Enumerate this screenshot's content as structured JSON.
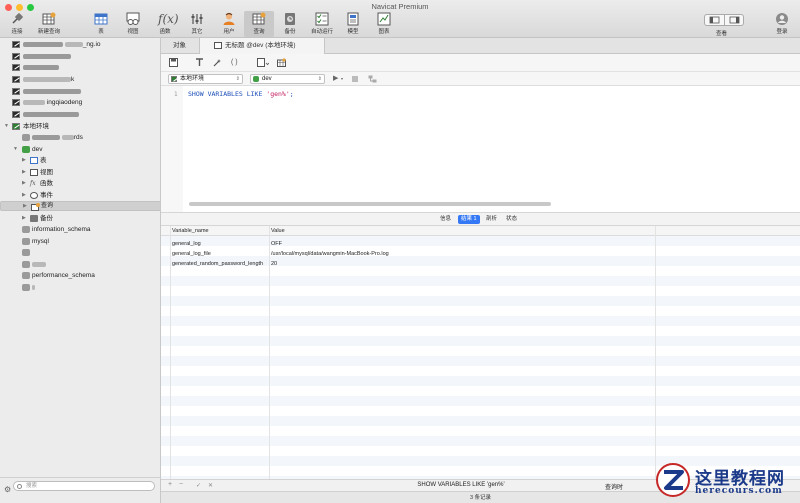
{
  "window": {
    "title": "Navicat Premium",
    "traffic_colors": [
      "#fe5f57",
      "#febc2e",
      "#28c840"
    ]
  },
  "toolbar": {
    "items": [
      {
        "label": "连接",
        "icon": "plug-connect-icon"
      },
      {
        "label": "新建查询",
        "icon": "new-query-grid-icon"
      },
      {
        "label": "表",
        "icon": "table-grid-icon"
      },
      {
        "label": "视图",
        "icon": "view-glasses-icon"
      },
      {
        "label": "函数",
        "icon": "function-fx-icon"
      },
      {
        "label": "其它",
        "icon": "tools-icon"
      },
      {
        "label": "用户",
        "icon": "user-icon"
      },
      {
        "label": "查询",
        "icon": "query-grid-icon",
        "active": true
      },
      {
        "label": "备份",
        "icon": "backup-icon"
      },
      {
        "label": "自动运行",
        "icon": "checklist-icon"
      },
      {
        "label": "模型",
        "icon": "model-icon"
      },
      {
        "label": "图表",
        "icon": "chart-icon"
      }
    ],
    "view_label": "查看",
    "login_label": "登录"
  },
  "sidebar": {
    "connections_blurred": [
      {
        "visible": "_ng​.io"
      },
      {
        "visible": ""
      },
      {
        "visible": ""
      },
      {
        "visible": "k"
      },
      {
        "visible": ""
      },
      {
        "visible": "ingqiaodeng"
      },
      {
        "visible": ""
      }
    ],
    "local_connection": "本地环境",
    "blurred_db_1": "rds",
    "dev_db": "dev",
    "dev_children": [
      {
        "label": "表",
        "icon": "table-icon"
      },
      {
        "label": "视图",
        "icon": "view-icon"
      },
      {
        "label": "函数",
        "icon": "function-icon"
      },
      {
        "label": "事件",
        "icon": "clock-event-icon"
      },
      {
        "label": "查询",
        "icon": "query-icon",
        "selected": true
      },
      {
        "label": "备份",
        "icon": "backup-icon"
      }
    ],
    "databases": [
      "information_schema",
      "mysql",
      "",
      "",
      "performance_schema",
      ""
    ],
    "search_placeholder": "搜索"
  },
  "tabs": {
    "objects": "对象",
    "query_tab": "无标题 @dev (本地环境)"
  },
  "selectors": {
    "connection": "本地环境",
    "database": "dev"
  },
  "editor": {
    "line_number": "1",
    "code_keyword": "SHOW VARIABLES LIKE ",
    "code_string": "'gen%'",
    "code_end": ";"
  },
  "result_tabs": [
    "信息",
    "结果 1",
    "剖析",
    "状态"
  ],
  "result_active_index": 1,
  "grid": {
    "columns": [
      "Variable_name",
      "Value"
    ],
    "rows": [
      [
        "general_log",
        "OFF"
      ],
      [
        "general_log_file",
        "/usr/local/mysql/data/wangmin-MacBook-Pro.log"
      ],
      [
        "generated_random_password_length",
        "20"
      ]
    ]
  },
  "footer": {
    "sql_text": "SHOW VARIABLES LIKE 'gen%'",
    "query_time_label": "查询时",
    "record_count": "3 条记录"
  },
  "watermark": {
    "title": "这里教程网",
    "url": "herecours.com",
    "color": "#1c3a8a"
  }
}
